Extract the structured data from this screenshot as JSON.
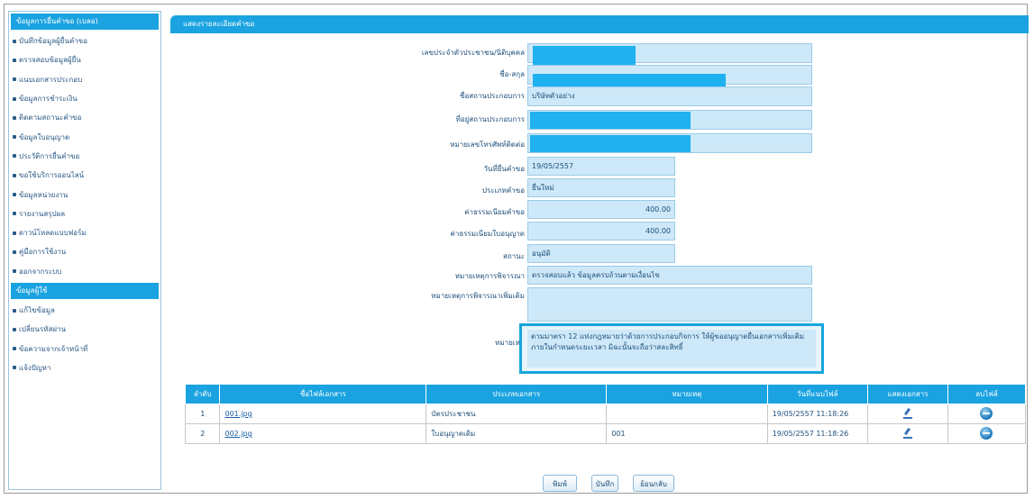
{
  "sidebar": {
    "section1_title": "ข้อมูลการยื่นคำขอ (เบลอ)",
    "items1": [
      "บันทึกข้อมูลผู้ยื่นคำขอ",
      "ตรวจสอบข้อมูลผู้ยื่น",
      "แนบเอกสารประกอบ",
      "ข้อมูลการชำระเงิน",
      "ติดตามสถานะคำขอ",
      "ข้อมูลใบอนุญาต",
      "ประวัติการยื่นคำขอ",
      "ขอใช้บริการออนไลน์",
      "ข้อมูลหน่วยงาน",
      "รายงานสรุปผล",
      "ดาวน์โหลดแบบฟอร์ม",
      "คู่มือการใช้งาน",
      "ออกจากระบบ"
    ],
    "section2_title": "ข้อมูลผู้ใช้",
    "items2": [
      "แก้ไขข้อมูล",
      "เปลี่ยนรหัสผ่าน",
      "ข้อความจากเจ้าหน้าที่",
      "แจ้งปัญหา"
    ]
  },
  "panel": {
    "title": "แสดงรายละเอียดคำขอ"
  },
  "form": {
    "labels": {
      "id_number": "เลขประจำตัวประชาชน/นิติบุคคล",
      "name": "ชื่อ-สกุล",
      "company": "ชื่อสถานประกอบการ",
      "address": "ที่อยู่สถานประกอบการ",
      "phone": "หมายเลขโทรศัพท์ติดต่อ",
      "date": "วันที่ยื่นคำขอ",
      "type": "ประเภทคำขอ",
      "fee1": "ค่าธรรมเนียมคำขอ",
      "fee2": "ค่าธรรมเนียมใบอนุญาต",
      "status": "สถานะ",
      "reason": "หมายเหตุการพิจารณา",
      "reason2": "หมายเหตุการพิจารณาเพิ่มเติม",
      "note": "หมายเหตุ"
    },
    "values": {
      "company": "บริษัทตัวอย่าง",
      "date": "19/05/2557",
      "type": "ยื่นใหม่",
      "fee1": "400.00",
      "fee2": "400.00",
      "status": "อนุมัติ",
      "reason": "ตรวจสอบแล้ว ข้อมูลครบถ้วนตามเงื่อนไข",
      "note": "ตามมาตรา 12 แห่งกฎหมายว่าด้วยการประกอบกิจการ ให้ผู้ขออนุญาตยื่นเอกสารเพิ่มเติมภายในกำหนดระยะเวลา มิฉะนั้นจะถือว่าสละสิทธิ์"
    }
  },
  "table": {
    "headers": [
      "ลำดับ",
      "ชื่อไฟล์เอกสาร",
      "ประเภทเอกสาร",
      "หมายเหตุ",
      "วันที่แนบไฟล์",
      "แสดงเอกสาร",
      "ลบไฟล์"
    ],
    "rows": [
      [
        "1",
        "001.jpg",
        "บัตรประชาชน",
        "",
        "19/05/2557 11:18:26"
      ],
      [
        "2",
        "002.jpg",
        "ใบอนุญาตเดิม",
        "001",
        "19/05/2557 11:18:26"
      ]
    ]
  },
  "buttons": {
    "print": "พิมพ์",
    "save": "บันทึก",
    "back": "ย้อนกลับ"
  },
  "colors": {
    "header_blue": "#1aa3e0",
    "field_bg": "#cde8f8",
    "redaction": "#1fb1f0"
  }
}
